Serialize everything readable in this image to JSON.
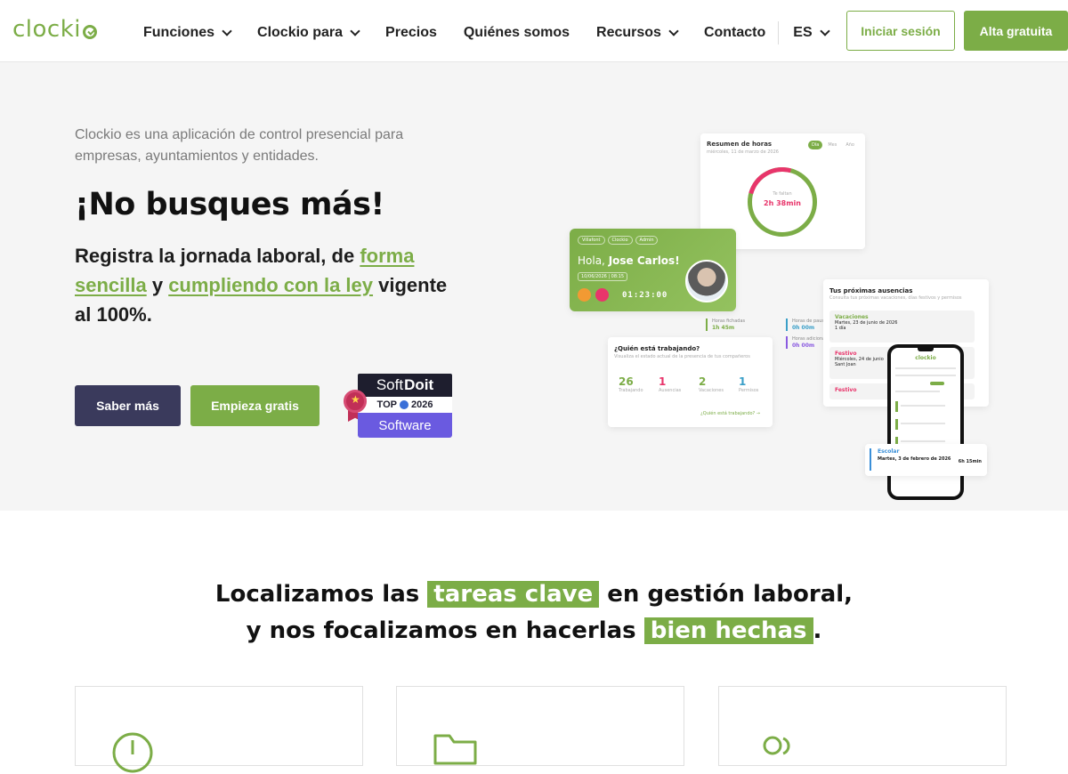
{
  "brand": {
    "name": "clocki",
    "accent": "#7cad47",
    "dark": "#3a3a5c"
  },
  "nav": {
    "items": [
      {
        "label": "Funciones",
        "dropdown": true
      },
      {
        "label": "Clockio para",
        "dropdown": true
      },
      {
        "label": "Precios",
        "dropdown": false
      },
      {
        "label": "Quiénes somos",
        "dropdown": false
      },
      {
        "label": "Recursos",
        "dropdown": true
      },
      {
        "label": "Contacto",
        "dropdown": false
      }
    ],
    "lang": "ES",
    "login_label": "Iniciar sesión",
    "signup_label": "Alta gratuita"
  },
  "hero": {
    "subtitle": "Clockio es una aplicación de control presencial para empresas, ayuntamientos y entidades.",
    "title": "¡No busques más!",
    "desc_1": "Registra la jornada laboral, de ",
    "link_1": "forma sencilla",
    "desc_2": " y ",
    "link_2": "cumpliendo con la ley",
    "desc_3": " vigente al 100%.",
    "btn_more": "Saber más",
    "btn_start": "Empieza gratis",
    "badge": {
      "brand_light": "Soft",
      "brand_bold": "Doit",
      "top": "TOP",
      "year": "2026",
      "category": "Software"
    }
  },
  "mock": {
    "summary": {
      "title": "Resumen de horas",
      "subtitle": "miércoles, 11 de marzo de 2026",
      "tabs": [
        "Día",
        "Mes",
        "Año"
      ],
      "ring_label": "Te faltan",
      "ring_value": "2h 38min"
    },
    "hello": {
      "tags": [
        "Villafont",
        "Clockio",
        "Admin"
      ],
      "greeting": "Hola,",
      "name": "Jose Carlos!",
      "date": "10/06/2026 | 08:15",
      "timer": "01:23:00"
    },
    "stats": [
      {
        "label": "Horas fichadas",
        "value": "1h 45m"
      },
      {
        "label": "Horas de pausa",
        "value": "0h 00m"
      },
      {
        "label": "Horas adicionales",
        "value": "0h 00m"
      }
    ],
    "who": {
      "title": "¿Quién está trabajando?",
      "subtitle": "Visualiza el estado actual de la presencia de tus compañeros",
      "counts": [
        {
          "value": "26",
          "label": "Trabajando"
        },
        {
          "value": "1",
          "label": "Ausencias"
        },
        {
          "value": "2",
          "label": "Vacaciones"
        },
        {
          "value": "1",
          "label": "Permisos"
        }
      ],
      "link": "¿Quién está trabajando? →"
    },
    "absences": {
      "title": "Tus próximas ausencias",
      "subtitle": "Consulta tus próximas vacaciones, días festivos y permisos",
      "rows": [
        {
          "type": "Vacaciones",
          "date": "Martes, 23 de junio de 2026",
          "extra": "1 día"
        },
        {
          "type": "Festivo",
          "date": "Miércoles, 24 de junio",
          "extra": "Sant Joan"
        },
        {
          "type": "Festivo",
          "date": "",
          "extra": ""
        }
      ]
    },
    "phone_app": "clockio",
    "school": {
      "type": "Escolar",
      "date": "Martes, 3 de febrero de 2026",
      "right": "6h 15min"
    }
  },
  "section2": {
    "line1_a": "Localizamos las ",
    "line1_hl": "tareas clave",
    "line1_b": " en gestión laboral,",
    "line2_a": "y nos focalizamos en hacerlas ",
    "line2_hl": "bien hechas",
    "line2_b": "."
  },
  "features": [
    {
      "icon": "clock-icon"
    },
    {
      "icon": "folder-icon"
    },
    {
      "icon": "users-icon"
    }
  ]
}
